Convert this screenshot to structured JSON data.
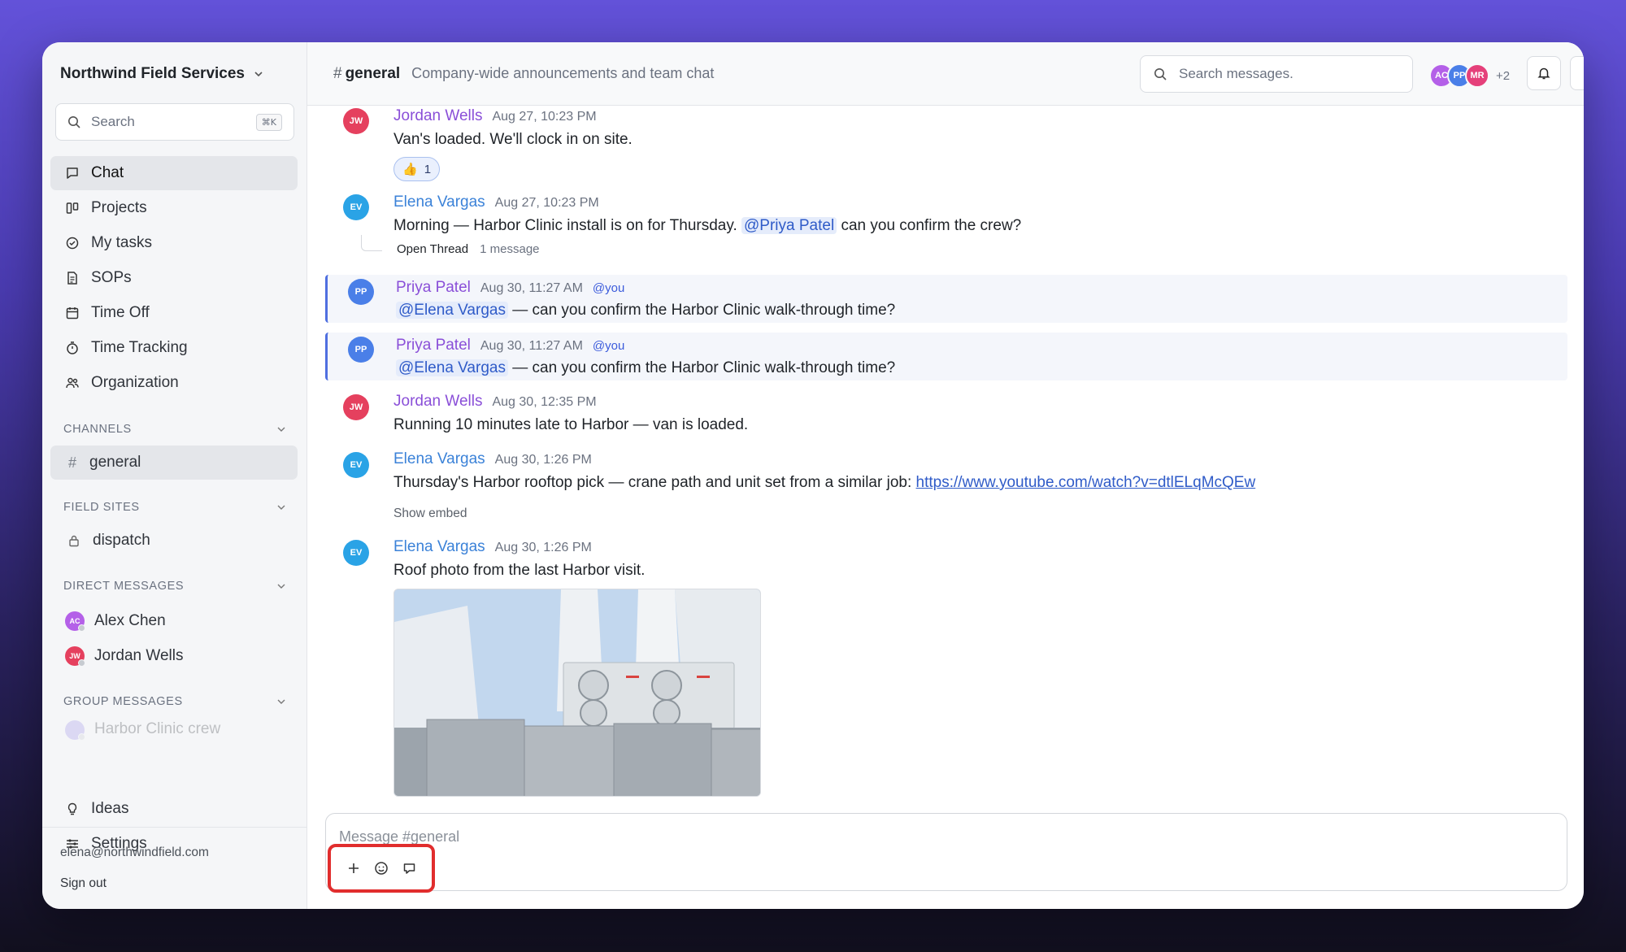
{
  "workspace": {
    "name": "Northwind Field Services"
  },
  "sidebar": {
    "search_placeholder": "Search",
    "search_shortcut": "⌘K",
    "nav": [
      {
        "label": "Chat",
        "icon": "chat-icon",
        "active": true
      },
      {
        "label": "Projects",
        "icon": "columns-icon"
      },
      {
        "label": "My tasks",
        "icon": "check-circle-icon"
      },
      {
        "label": "SOPs",
        "icon": "document-icon"
      },
      {
        "label": "Time Off",
        "icon": "calendar-icon"
      },
      {
        "label": "Time Tracking",
        "icon": "stopwatch-icon"
      },
      {
        "label": "Organization",
        "icon": "people-icon"
      }
    ],
    "sections": {
      "channels": {
        "title": "CHANNELS",
        "items": [
          {
            "label": "general",
            "active": true
          }
        ]
      },
      "field_sites": {
        "title": "FIELD SITES",
        "items": [
          {
            "label": "dispatch"
          }
        ]
      },
      "direct_messages": {
        "title": "DIRECT MESSAGES",
        "items": [
          {
            "label": "Alex Chen",
            "initials": "AC",
            "color": "#b460e8"
          },
          {
            "label": "Jordan Wells",
            "initials": "JW",
            "color": "#e5405e"
          }
        ]
      },
      "group_messages": {
        "title": "GROUP MESSAGES",
        "items": [
          {
            "label": "Harbor Clinic crew"
          }
        ]
      }
    },
    "bottom_nav": [
      {
        "label": "Ideas",
        "icon": "lightbulb-icon"
      },
      {
        "label": "Settings",
        "icon": "sliders-icon"
      }
    ],
    "account": {
      "email": "elena@northwindfield.com",
      "sign_out": "Sign out"
    }
  },
  "header": {
    "channel_hash": "#",
    "channel_name": "general",
    "channel_description": "Company-wide announcements and team chat",
    "search_placeholder": "Search messages.",
    "members": [
      {
        "initials": "AC",
        "color": "#b460e8"
      },
      {
        "initials": "PP",
        "color": "#4a7fe8"
      },
      {
        "initials": "MR",
        "color": "#e5407a"
      }
    ],
    "members_more": "+2",
    "help_label": "?"
  },
  "messages": [
    {
      "author": "Jordan Wells",
      "initials": "JW",
      "author_color": "#8a4fd8",
      "avatar_color": "#e5405e",
      "time": "Aug 27, 10:23 PM",
      "text": "Van's loaded. We'll clock in on site.",
      "reaction": {
        "emoji": "👍",
        "count": "1"
      }
    },
    {
      "author": "Elena Vargas",
      "initials": "EV",
      "author_color": "#3b82d8",
      "avatar_color": "#2aa3e6",
      "time": "Aug 27, 10:23 PM",
      "text_before": "Morning — Harbor Clinic install is on for Thursday.",
      "mention": "@Priya Patel",
      "text_after": "can you confirm the crew?",
      "thread": {
        "label": "Open Thread",
        "count": "1 message"
      }
    },
    {
      "author": "Priya Patel",
      "initials": "PP",
      "author_color": "#8a4fd8",
      "avatar_color": "#4a7fe8",
      "time": "Aug 30, 11:27 AM",
      "you_tag": "@you",
      "mention": "@Elena Vargas",
      "text_after": "— can you confirm the Harbor Clinic walk-through time?"
    },
    {
      "author": "Priya Patel",
      "initials": "PP",
      "author_color": "#8a4fd8",
      "avatar_color": "#4a7fe8",
      "time": "Aug 30, 11:27 AM",
      "you_tag": "@you",
      "mention": "@Elena Vargas",
      "text_after": "— can you confirm the Harbor Clinic walk-through time?"
    },
    {
      "author": "Jordan Wells",
      "initials": "JW",
      "author_color": "#8a4fd8",
      "avatar_color": "#e5405e",
      "time": "Aug 30, 12:35 PM",
      "text": "Running 10 minutes late to Harbor — van is loaded."
    },
    {
      "author": "Elena Vargas",
      "initials": "EV",
      "author_color": "#3b82d8",
      "avatar_color": "#2aa3e6",
      "time": "Aug 30, 1:26 PM",
      "text_before": "Thursday's Harbor rooftop pick — crane path and unit set from a similar job:",
      "link": "https://www.youtube.com/watch?v=dtlELqMcQEw",
      "embed_toggle": "Show embed"
    },
    {
      "author": "Elena Vargas",
      "initials": "EV",
      "author_color": "#3b82d8",
      "avatar_color": "#2aa3e6",
      "time": "Aug 30, 1:26 PM",
      "text": "Roof photo from the last Harbor visit."
    }
  ],
  "composer": {
    "placeholder": "Message #general"
  }
}
